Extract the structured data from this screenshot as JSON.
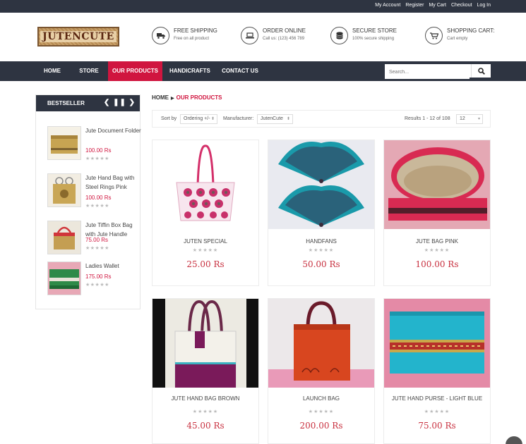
{
  "top_links": [
    "My Account",
    "Register",
    "My Cart",
    "Checkout",
    "Log In"
  ],
  "logo": {
    "text": "JUTENCUTE"
  },
  "features": [
    {
      "title": "Free Shipping",
      "sub": "Free on all product",
      "icon": "truck-icon"
    },
    {
      "title": "Order Online",
      "sub": "Call us: (123) 456 789",
      "icon": "laptop-icon"
    },
    {
      "title": "Secure Store",
      "sub": "100% secure shipping",
      "icon": "database-icon"
    },
    {
      "title": "Shopping Cart:",
      "sub": "Cart empty",
      "icon": "cart-icon"
    }
  ],
  "nav": [
    "Home",
    "Store",
    "Our Products",
    "Handicrafts",
    "Contact Us"
  ],
  "nav_active": "Our Products",
  "search": {
    "placeholder": "Search..."
  },
  "sidebar": {
    "title": "Bestseller",
    "controls": "❮ ❚❚ ❯",
    "items": [
      {
        "name": "Jute Document Folder",
        "price": "100.00 Rs",
        "rating": "★★★★★"
      },
      {
        "name": "Jute Hand Bag with Steel Rings Pink",
        "price": "100.00 Rs",
        "rating": "★★★★★"
      },
      {
        "name": "Jute Tiffin Box Bag with Jute Handle",
        "price": "75.00 Rs",
        "rating": "★★★★★"
      },
      {
        "name": "Ladies Wallet",
        "price": "175.00 Rs",
        "rating": "★★★★★"
      }
    ]
  },
  "breadcrumb": {
    "home": "Home",
    "current": "Our Products"
  },
  "sortbar": {
    "sort_label": "Sort by",
    "sort_value": "Ordering +/-",
    "manufacturer_label": "Manufacturer:",
    "manufacturer_value": "JutenCute",
    "results": "Results 1 - 12 of 108",
    "per_page": "12"
  },
  "products": [
    {
      "name": "Juten Special",
      "price": "25.00 Rs",
      "rating": "★★★★★"
    },
    {
      "name": "Handfans",
      "price": "50.00 Rs",
      "rating": "★★★★★"
    },
    {
      "name": "Jute Bag Pink",
      "price": "100.00 Rs",
      "rating": "★★★★★"
    },
    {
      "name": "Jute Hand Bag Brown",
      "price": "45.00 Rs",
      "rating": "★★★★★"
    },
    {
      "name": "Launch Bag",
      "price": "200.00 Rs",
      "rating": "★★★★★"
    },
    {
      "name": "Jute Hand Purse - Light Blue",
      "price": "75.00 Rs",
      "rating": "★★★★★"
    }
  ],
  "colors": {
    "dark": "#2e3441",
    "accent": "#d0153f",
    "price": "#c8303f"
  }
}
